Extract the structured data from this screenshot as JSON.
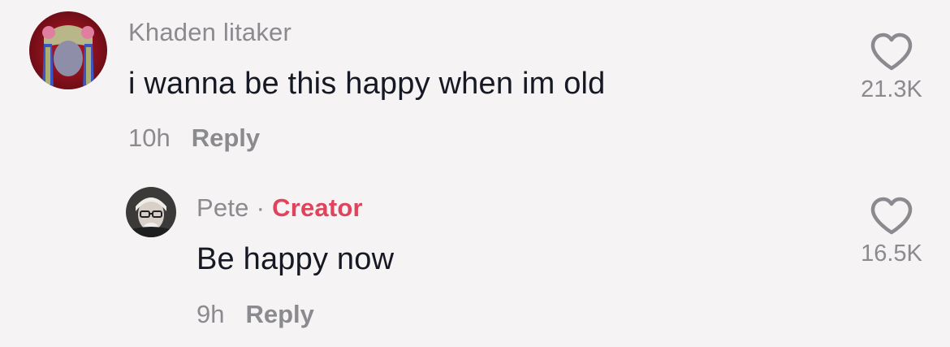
{
  "comments": [
    {
      "author": "Khaden litaker",
      "text": "i wanna be this happy when im old",
      "time": "10h",
      "reply_label": "Reply",
      "likes": "21.3K",
      "avatar_icon": "user-avatar-photo"
    }
  ],
  "reply": {
    "author": "Pete",
    "separator": "·",
    "badge": "Creator",
    "text": "Be happy now",
    "time": "9h",
    "reply_label": "Reply",
    "likes": "16.5K",
    "avatar_icon": "user-avatar-photo"
  },
  "colors": {
    "background": "#f5f3f3",
    "primary_text": "#161823",
    "secondary_text": "#8a8a8f",
    "creator_badge": "#e0435c"
  }
}
